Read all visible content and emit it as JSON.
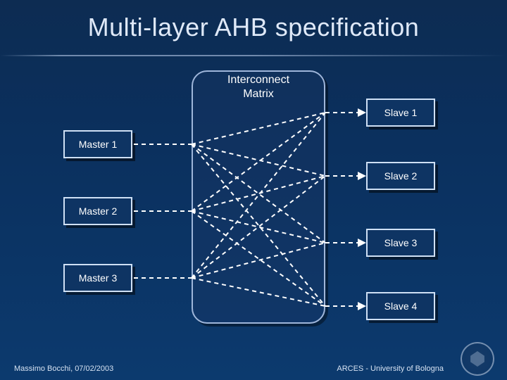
{
  "title": "Multi-layer AHB specification",
  "matrix_label_line1": "Interconnect",
  "matrix_label_line2": "Matrix",
  "masters": {
    "m1": "Master 1",
    "m2": "Master 2",
    "m3": "Master 3"
  },
  "slaves": {
    "s1": "Slave 1",
    "s2": "Slave 2",
    "s3": "Slave 3",
    "s4": "Slave 4"
  },
  "footer": {
    "left": "Massimo Bocchi, 07/02/2003",
    "right": "ARCES - University of Bologna"
  },
  "colors": {
    "bg_top": "#0d2c52",
    "bg_bottom": "#0c3a6e",
    "block_border": "#cfe0f5",
    "block_fill": "#0e3463",
    "line": "#ffffff"
  }
}
